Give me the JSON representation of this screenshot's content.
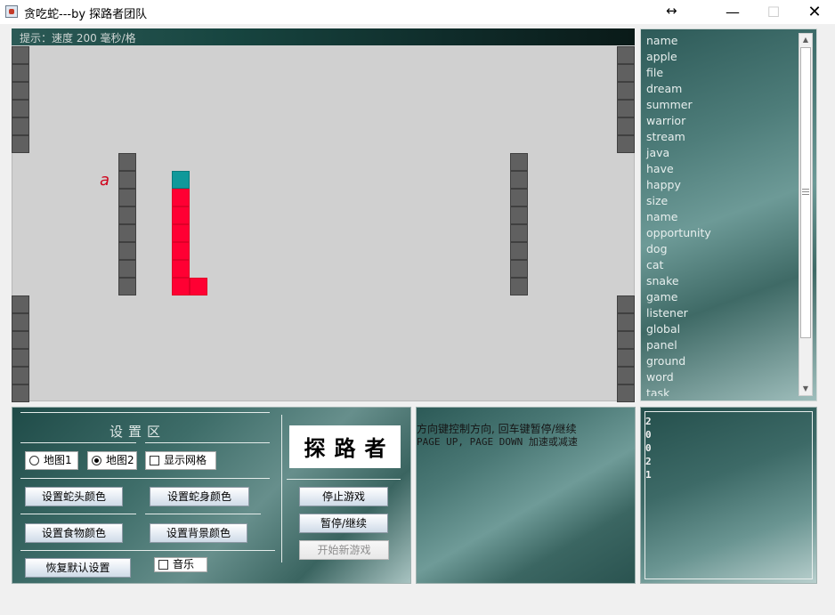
{
  "window": {
    "title": "贪吃蛇---by 探路者团队",
    "resize_glyph": "↔",
    "minimize_glyph": "—",
    "maximize_glyph": "☐",
    "close_glyph": "✕"
  },
  "game": {
    "status_text": "提示：速度 200 毫秒/格",
    "food_char": "a",
    "grid_cols": 35,
    "grid_rows": 21,
    "snake_head_color": "#10999a",
    "snake_body_color": "#ff0033",
    "wall_color": "#606060",
    "background_color": "#d0d0d0"
  },
  "words": [
    "name",
    "apple",
    "file",
    "dream",
    "summer",
    "warrior",
    "stream",
    "java",
    "have",
    "happy",
    "size",
    "name",
    "opportunity",
    "dog",
    "cat",
    "snake",
    "game",
    "listener",
    "global",
    "panel",
    "ground",
    "word",
    "task"
  ],
  "settings": {
    "title": "设置区",
    "map1_label": "地图1",
    "map2_label": "地图2",
    "map2_selected": true,
    "grid_label": "显示网格",
    "grid_checked": false,
    "head_color_label": "设置蛇头颜色",
    "body_color_label": "设置蛇身颜色",
    "food_color_label": "设置食物颜色",
    "bg_color_label": "设置背景颜色",
    "restore_label": "恢复默认设置",
    "music_label": "音乐",
    "music_checked": false,
    "logo_text": "探路者",
    "stop_label": "停止游戏",
    "pause_label": "暂停/继续",
    "new_game_label": "开始新游戏"
  },
  "info": {
    "line1": "方向键控制方向, 回车键暂停/继续",
    "line2": "PAGE UP, PAGE DOWN 加速或减速"
  },
  "score": {
    "digits": [
      "2",
      "0",
      "0",
      "2",
      "1"
    ]
  }
}
